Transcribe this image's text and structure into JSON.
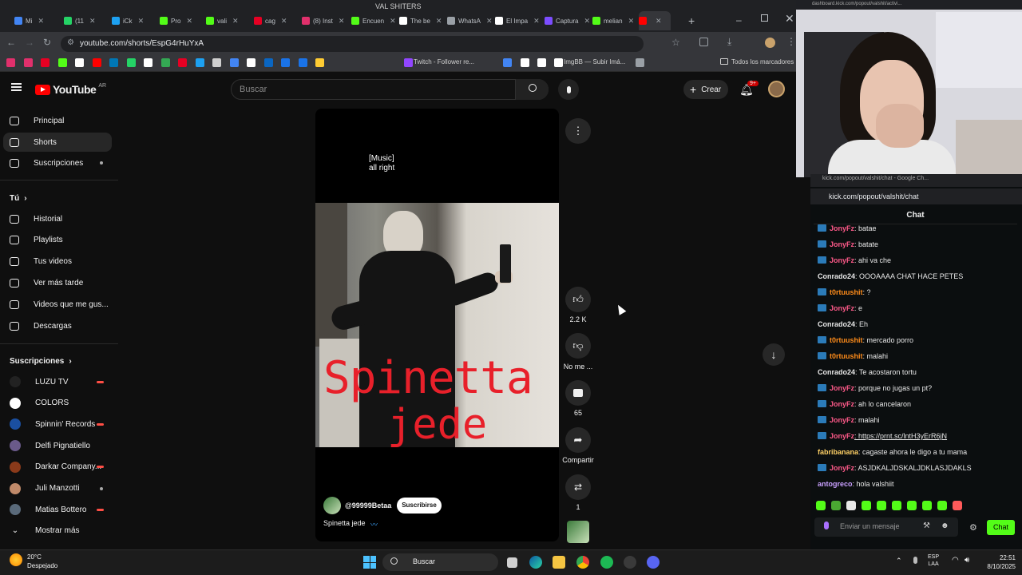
{
  "browser": {
    "window_title": "VAL SHITERS",
    "tabs": [
      {
        "label": "Mi",
        "color": "#4285f4"
      },
      {
        "label": "(11",
        "color": "#25d366"
      },
      {
        "label": "iCk",
        "color": "#1da1f2"
      },
      {
        "label": "Pro",
        "color": "#53fc18"
      },
      {
        "label": "vali",
        "color": "#53fc18"
      },
      {
        "label": "cag",
        "color": "#e60023"
      },
      {
        "label": "(8) Inst",
        "color": "#e1306c"
      },
      {
        "label": "Encuen",
        "color": "#53fc18"
      },
      {
        "label": "The be",
        "color": "#ffffff"
      },
      {
        "label": "WhatsA",
        "color": "#9aa0a6"
      },
      {
        "label": "El Impa",
        "color": "#ffffff"
      },
      {
        "label": "Captura",
        "color": "#7c4dff"
      },
      {
        "label": "melian",
        "color": "#53fc18"
      },
      {
        "label": "",
        "color": "#ff0000"
      }
    ],
    "url": "youtube.com/shorts/EspG4rHuYxA",
    "bookmarks": {
      "twitch": "Twitch - Follower re...",
      "imgbb": "ImgBB — Subir Imá...",
      "all": "Todos los marcadores"
    }
  },
  "youtube": {
    "logo_text": "YouTube",
    "country": "AR",
    "search_placeholder": "Buscar",
    "create_label": "Crear",
    "notif_badge": "9+",
    "sidebar": {
      "main": [
        {
          "label": "Principal",
          "icon": "home-icon"
        },
        {
          "label": "Shorts",
          "icon": "shorts-icon"
        },
        {
          "label": "Suscripciones",
          "icon": "subscriptions-icon"
        }
      ],
      "you_header": "Tú",
      "you": [
        {
          "label": "Historial",
          "icon": "history-icon"
        },
        {
          "label": "Playlists",
          "icon": "playlist-icon"
        },
        {
          "label": "Tus videos",
          "icon": "video-icon"
        },
        {
          "label": "Ver más tarde",
          "icon": "clock-icon"
        },
        {
          "label": "Videos que me gus...",
          "icon": "thumb-up-icon"
        },
        {
          "label": "Descargas",
          "icon": "download-icon"
        }
      ],
      "subs_header": "Suscripciones",
      "subs": [
        {
          "label": "LUZU TV",
          "color": "#222"
        },
        {
          "label": "COLORS",
          "color": "#fff"
        },
        {
          "label": "Spinnin' Records",
          "color": "#1a4fa0"
        },
        {
          "label": "Delfi Pignatiello",
          "color": "#6a5a8a"
        },
        {
          "label": "Darkar Company...",
          "color": "#8a3a1a"
        },
        {
          "label": "Juli Manzotti",
          "color": "#c08a6a"
        },
        {
          "label": "Matias Bottero",
          "color": "#5a6a7a"
        }
      ],
      "show_more": "Mostrar más"
    },
    "short": {
      "caption_line1": "[Music]",
      "caption_line2": "all right",
      "overlay_line1": "Spinetta",
      "overlay_line2": "jede",
      "channel": "@99999Betaa",
      "subscribe": "Suscribirse",
      "title": "Spinetta jede",
      "likes": "2.2 K",
      "dislike_label": "No me ...",
      "comments": "65",
      "share_label": "Compartir",
      "remix_count": "1"
    }
  },
  "chat": {
    "window_title": "kick.com/popout/valshit/chat - Google Ch...",
    "url": "kick.com/popout/valshit/chat",
    "header": "Chat",
    "input_placeholder": "Enviar un mensaje",
    "send_label": "Chat",
    "messages": [
      {
        "user": "JonyFz",
        "text": ": batae",
        "color": "#ff5a8a",
        "badge": true
      },
      {
        "user": "JonyFz",
        "text": ": batate",
        "color": "#ff5a8a",
        "badge": true
      },
      {
        "user": "JonyFz",
        "text": ": ahi va che",
        "color": "#ff5a8a",
        "badge": true
      },
      {
        "user": "Conrado24",
        "text": ": OOOAAAA CHAT HACE PETES",
        "color": "#e8e8e8",
        "badge": false
      },
      {
        "user": "t0rtuushit",
        "text": ": ?",
        "color": "#ff8c1a",
        "badge": true
      },
      {
        "user": "JonyFz",
        "text": ": e",
        "color": "#ff5a8a",
        "badge": true
      },
      {
        "user": "Conrado24",
        "text": ": Eh",
        "color": "#e8e8e8",
        "badge": false
      },
      {
        "user": "t0rtuushit",
        "text": ": mercado porro",
        "color": "#ff8c1a",
        "badge": true
      },
      {
        "user": "t0rtuushit",
        "text": ": malahi",
        "color": "#ff8c1a",
        "badge": true
      },
      {
        "user": "Conrado24",
        "text": ": Te acostaron tortu",
        "color": "#e8e8e8",
        "badge": false
      },
      {
        "user": "JonyFz",
        "text": ": porque no jugas un pt?",
        "color": "#ff5a8a",
        "badge": true
      },
      {
        "user": "JonyFz",
        "text": ": ah lo cancelaron",
        "color": "#ff5a8a",
        "badge": true
      },
      {
        "user": "JonyFz",
        "text": ": malahi",
        "color": "#ff5a8a",
        "badge": true
      },
      {
        "user": "JonyFz",
        "text": ": https://prnt.sc/lntH3yErR6jN",
        "color": "#ff5a8a",
        "badge": true
      },
      {
        "user": "fabribanana",
        "text": ": cagaste ahora le digo a tu mama",
        "color": "#ffd166",
        "badge": false
      },
      {
        "user": "JonyFz",
        "text": ": ASJDKALJDSKALJDKLASJDAKLS",
        "color": "#ff5a8a",
        "badge": true
      },
      {
        "user": "antogreco",
        "text": ": hola valshiit",
        "color": "#c9a0ff",
        "badge": false
      }
    ]
  },
  "taskbar": {
    "weather_temp": "20°C",
    "weather_desc": "Despejado",
    "search": "Buscar",
    "lang_top": "ESP",
    "lang_bottom": "LAA",
    "time": "22:51",
    "date": "8/10/2025"
  }
}
